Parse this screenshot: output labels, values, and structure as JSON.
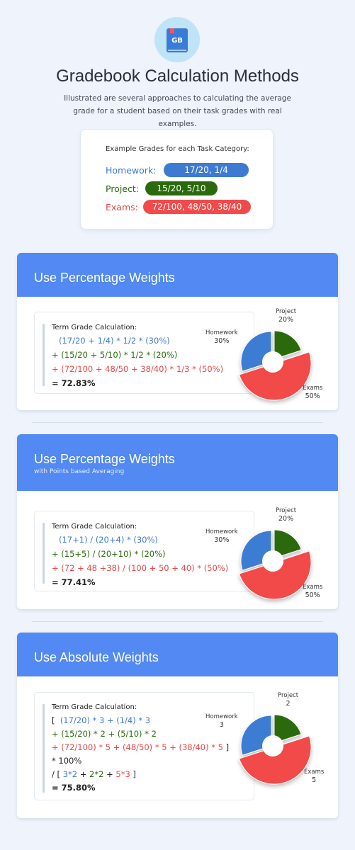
{
  "logo": {
    "text": "GB",
    "icon": "gradebook-icon"
  },
  "title": "Gradebook Calculation Methods",
  "subtitle": "Illustrated are several approaches to calculating the average grade for a student based on their task grades with real examples.",
  "example": {
    "heading": "Example Grades for each Task Category:",
    "rows": [
      {
        "label": "Homework:",
        "value": "17/20, 1/4",
        "color": "#3d7bd3"
      },
      {
        "label": "Project:",
        "value": "15/20, 5/10",
        "color": "#2a6a0c"
      },
      {
        "label": "Exams:",
        "value": "72/100, 48/50, 38/40",
        "color": "#f24a4a"
      }
    ]
  },
  "colors": {
    "homework": "#3d7bd3",
    "project": "#2a6a0c",
    "exams": "#f24a4a",
    "header": "#5289f2"
  },
  "sections": [
    {
      "title": "Use Percentage Weights",
      "subtitle": "",
      "calc_heading": "Term Grade Calculation:",
      "lines": [
        "(17/20 + 1/4) * 1/2 * (30%)",
        "+ (15/20 + 5/10) * 1/2 * (20%)",
        "+ (72/100 + 48/50 + 38/40) * 1/3 * (50%)",
        "= 72.83%"
      ],
      "pie": {
        "homework_label": "Homework",
        "homework_value": "30%",
        "project_label": "Project",
        "project_value": "20%",
        "exams_label": "Exams",
        "exams_value": "50%",
        "weights": [
          30,
          20,
          50
        ]
      }
    },
    {
      "title": "Use Percentage Weights",
      "subtitle": "with Points based Averaging",
      "calc_heading": "Term Grade Calculation:",
      "lines": [
        "(17+1) / (20+4) * (30%)",
        "+ (15+5) / (20+10) * (20%)",
        "+ (72 + 48 +38) / (100 + 50 + 40) * (50%)",
        "= 77.41%"
      ],
      "pie": {
        "homework_label": "Homework",
        "homework_value": "30%",
        "project_label": "Project",
        "project_value": "20%",
        "exams_label": "Exams",
        "exams_value": "50%",
        "weights": [
          30,
          20,
          50
        ]
      }
    },
    {
      "title": "Use Absolute Weights",
      "subtitle": "",
      "calc_heading": "Term Grade Calculation:",
      "lines": [
        "[",
        "(17/20) * 3 + (1/4) * 3",
        "+ (15/20) * 2 + (5/10) * 2",
        "+ (72/100) * 5 + (48/50) * 5 + (38/40) * 5",
        "]",
        "* 100%",
        "/ [",
        "3*2",
        " + ",
        "2*2",
        " + ",
        "5*3",
        " ]",
        "= 75.80%"
      ],
      "pie": {
        "homework_label": "Homework",
        "homework_value": "3",
        "project_label": "Project",
        "project_value": "2",
        "exams_label": "Exams",
        "exams_value": "5",
        "weights": [
          3,
          2,
          5
        ]
      }
    }
  ]
}
